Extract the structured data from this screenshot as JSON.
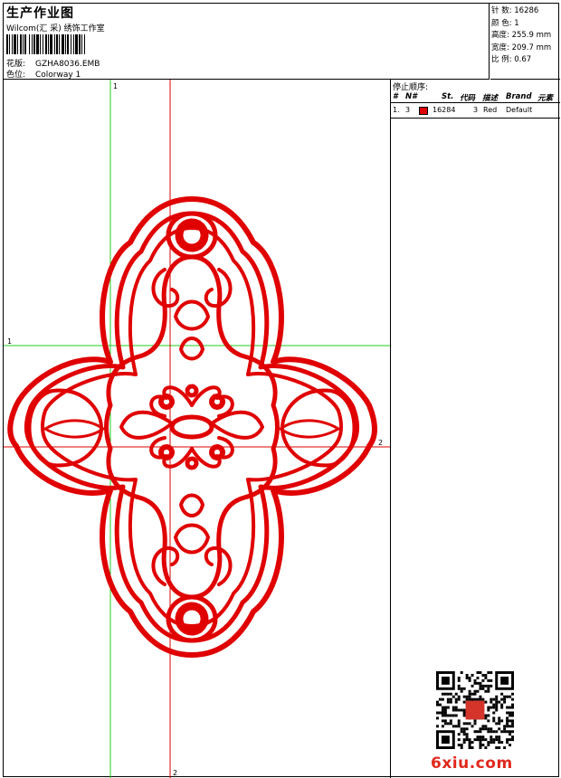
{
  "header": {
    "title": "生产作业图",
    "company": "Wilcom(汇 采) 绣饰工作室",
    "design_label": "花版:",
    "design_value": "GZHA8036.EMB",
    "colorway_label": "色位:",
    "colorway_value": "Colorway 1"
  },
  "specs": {
    "stitches": "针 数: 16286",
    "colors": "颜 色: 1",
    "height": "高度: 255.9 mm",
    "width": "宽度: 209.7 mm",
    "scale": "比 例: 0.67"
  },
  "stop_sequence": {
    "title": "停止顺序:",
    "headers": {
      "hash": "#",
      "n": "N#",
      "st": "St.",
      "code": "代码",
      "desc": "描述",
      "brand": "Brand",
      "element": "元素"
    },
    "rows": [
      {
        "hash": "1.",
        "n": "3",
        "color": "#e00000",
        "st": "16284",
        "code": "3",
        "desc": "Red",
        "brand": "Default"
      }
    ]
  },
  "guides": {
    "v1": "1",
    "h1": "1",
    "v2": "2",
    "h2": "2"
  },
  "watermark": {
    "site": "6xiu.com"
  },
  "colors": {
    "thread": "#e00000",
    "guide_green": "#22cc22",
    "guide_red": "#dd0000"
  }
}
